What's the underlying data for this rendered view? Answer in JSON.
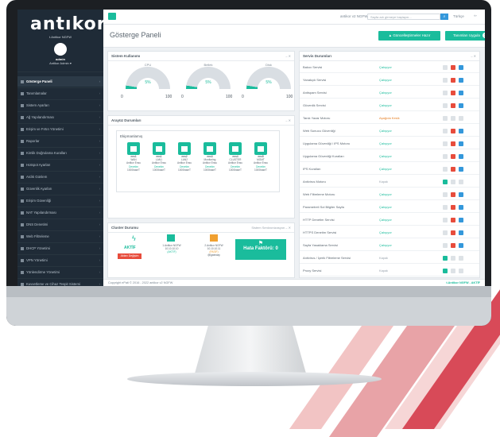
{
  "brand": {
    "logo": "antıkor",
    "product": "t.Antikor NGFW",
    "user": "admin",
    "user_role": "Antikor Admin ▾"
  },
  "topbar": {
    "version_text": "antikor v2 NGFW",
    "search_placeholder": "Sayfa adı girmeye başlayın...",
    "lang": "Türkçe"
  },
  "page": {
    "title": "Gösterge Paneli"
  },
  "buttons": {
    "updates": "Güncelleştirmeler Hazır",
    "alerts": "Tanımları Uygula",
    "alerts_count": "1"
  },
  "sidebar": {
    "items": [
      {
        "label": "Gösterge Paneli",
        "active": true
      },
      {
        "label": "Tanımlamalar"
      },
      {
        "label": "Sistem Ayarları"
      },
      {
        "label": "Ağ Yapılandırması"
      },
      {
        "label": "Erişim ve Fırtın Yönetimi"
      },
      {
        "label": "Raporlar"
      },
      {
        "label": "Kimlik Doğrulama Kuralları"
      },
      {
        "label": "Hotspot Ayarları"
      },
      {
        "label": "Ardık Günlem"
      },
      {
        "label": "Güvenlik Ayarları"
      },
      {
        "label": "Erişim Güvenliği"
      },
      {
        "label": "NAT Yapılandırması"
      },
      {
        "label": "DNS Denetimi"
      },
      {
        "label": "Web Filtreleme"
      },
      {
        "label": "DHCP Yönetimi"
      },
      {
        "label": "VPN Yönetimi"
      },
      {
        "label": "Yönlendirme Yönetimi"
      },
      {
        "label": "Kuvvetleme ve Cihaz Tespit Sistemi"
      }
    ]
  },
  "system_panel": {
    "title": "Sistem Kullanımı",
    "gauges": [
      {
        "label": "CPU",
        "value": "5%",
        "min": "0",
        "max": "100"
      },
      {
        "label": "Bellek",
        "value": "5%",
        "min": "0",
        "max": "100"
      },
      {
        "label": "Disk",
        "value": "5%",
        "min": "0",
        "max": "100"
      }
    ]
  },
  "interfaces_panel": {
    "title": "Arayüz Durumları",
    "subtitle": "Ekipmanlamış",
    "ports": [
      {
        "name": "ens1",
        "alias": "WAN",
        "zone": "Antikor Ensu",
        "state": "Denetim",
        "speed": "1000baseT"
      },
      {
        "name": "ens1",
        "alias": "LAN1",
        "zone": "Antikor Ensu",
        "state": "Denetim",
        "speed": "1000baseT"
      },
      {
        "name": "ens2",
        "alias": "LAN2",
        "zone": "Antikor Ensu",
        "state": "Denetim",
        "speed": "1000baseT"
      },
      {
        "name": "ens3",
        "alias": "Monitoring",
        "zone": "Antikor Ensu",
        "state": "Denetim",
        "speed": "1000baseT"
      },
      {
        "name": "ens4",
        "alias": "CLUSTER",
        "zone": "Antikor Ensu",
        "state": "Denetim",
        "speed": "1000baseT"
      },
      {
        "name": "ens5",
        "alias": "MGMT",
        "zone": "Antikor Ensu",
        "state": "Denetim",
        "speed": "1000baseT"
      }
    ]
  },
  "cluster_panel": {
    "title": "Cluster Durumu",
    "tools": "Sistem Senkronizasyon",
    "status": "AKTİF",
    "status_btn": "Aktarı Değişim",
    "node1": {
      "name": "1.Antikor NGFW",
      "ip": "10.10.10.10",
      "state": "(AKTİF)"
    },
    "node2": {
      "name": "2.Antikor NGFW",
      "ip": "10.10.10.11",
      "state": "(PASİF)",
      "note": "@igateway"
    },
    "fault": "Hata Faktörü: 0"
  },
  "services_panel": {
    "title": "Servis Durumları",
    "rows": [
      {
        "name": "Bakıcı Servisi",
        "status": "Çalışıyor",
        "kind": "ok"
      },
      {
        "name": "Yanakçık Servisi",
        "status": "Çalışıyor",
        "kind": "ok"
      },
      {
        "name": "Antispam Servisi",
        "status": "Çalışıyor",
        "kind": "ok"
      },
      {
        "name": "Güvenlik Servisi",
        "status": "Çalışıyor",
        "kind": "ok"
      },
      {
        "name": "Tanık Yazar Motoru",
        "status": "Aşağıda Kesik",
        "kind": "warn"
      },
      {
        "name": "Web Sunucu Güvenliği",
        "status": "Çalışıyor",
        "kind": "ok"
      },
      {
        "name": "Uygulama Güvenliği / IPS Motoru",
        "status": "Çalışıyor",
        "kind": "ok"
      },
      {
        "name": "Uygulama Güvenliği Kuralları",
        "status": "Çalışıyor",
        "kind": "ok"
      },
      {
        "name": "IPS Kuralları",
        "status": "Çalışıyor",
        "kind": "ok"
      },
      {
        "name": "Antivirus Motoru",
        "status": "Kapalı",
        "kind": "off"
      },
      {
        "name": "Web Filtreleme Motoru",
        "status": "Çalışıyor",
        "kind": "ok"
      },
      {
        "name": "Parametreli Sol Bilgiler Sayfa",
        "status": "Çalışıyor",
        "kind": "ok"
      },
      {
        "name": "HTTP Denetim Servisi",
        "status": "Çalışıyor",
        "kind": "ok"
      },
      {
        "name": "HTTPS Denetim Servisi",
        "status": "Çalışıyor",
        "kind": "ok"
      },
      {
        "name": "Sayfa Yasaklama Servisi",
        "status": "Çalışıyor",
        "kind": "ok"
      },
      {
        "name": "Antivirus / İçerik Filtreleme Servisi",
        "status": "Kapalı",
        "kind": "off"
      },
      {
        "name": "Proxy Servisi",
        "status": "Kapalı",
        "kind": "off"
      }
    ]
  },
  "footer": {
    "text": "Copyright ePati © 2016 - 2022 antikor v2 NGFW",
    "right": "t.Antikor NGFW - AKTİF"
  },
  "colors": {
    "accent": "#1abc9c",
    "sidebar": "#1f2b37",
    "danger": "#e74c3c",
    "info": "#3498db"
  }
}
